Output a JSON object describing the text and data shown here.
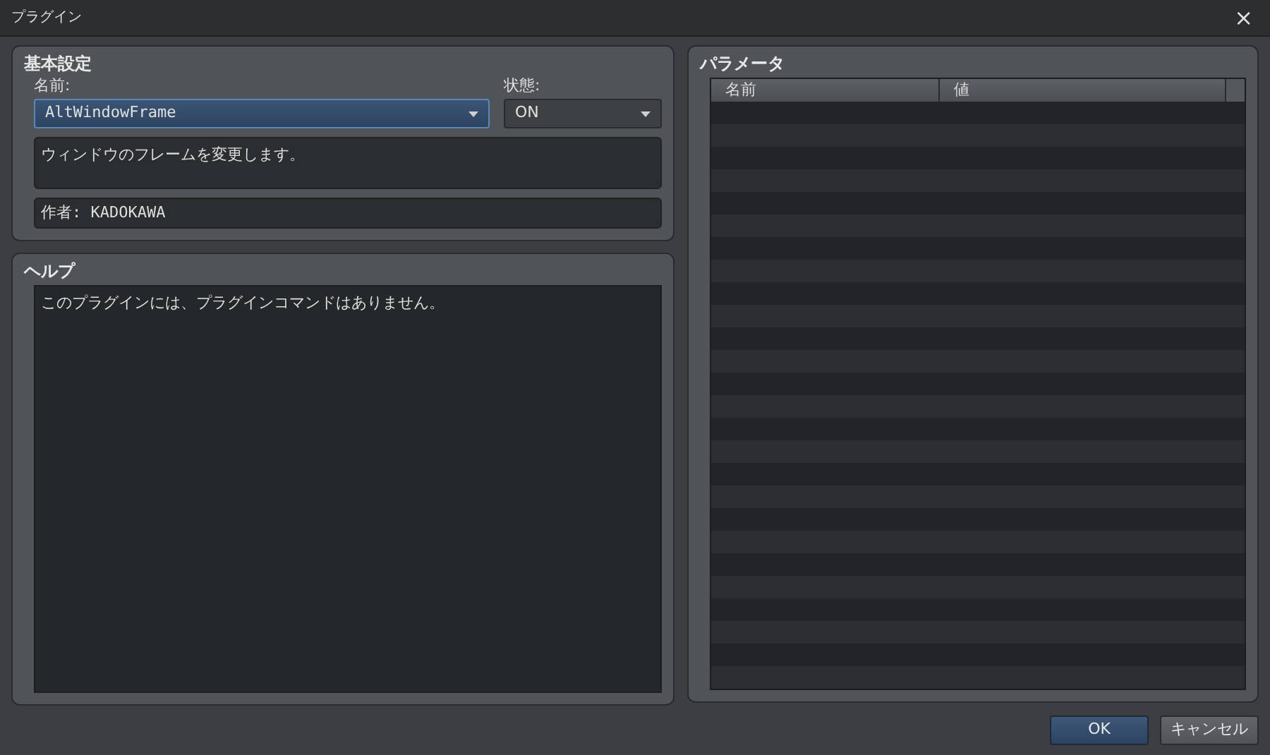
{
  "window": {
    "title": "プラグイン",
    "close": "×"
  },
  "basic": {
    "title": "基本設定",
    "name_label": "名前:",
    "name_value": "AltWindowFrame",
    "status_label": "状態:",
    "status_value": "ON",
    "description": "ウィンドウのフレームを変更します。",
    "author": "作者: KADOKAWA"
  },
  "help": {
    "title": "ヘルプ",
    "text": "このプラグインには、プラグインコマンドはありません。"
  },
  "parameters": {
    "title": "パラメータ",
    "columns": [
      "名前",
      "値"
    ]
  },
  "buttons": [
    {
      "label": "OK",
      "kind": "primary"
    },
    {
      "label": "キャンセル",
      "kind": "secondary"
    }
  ]
}
